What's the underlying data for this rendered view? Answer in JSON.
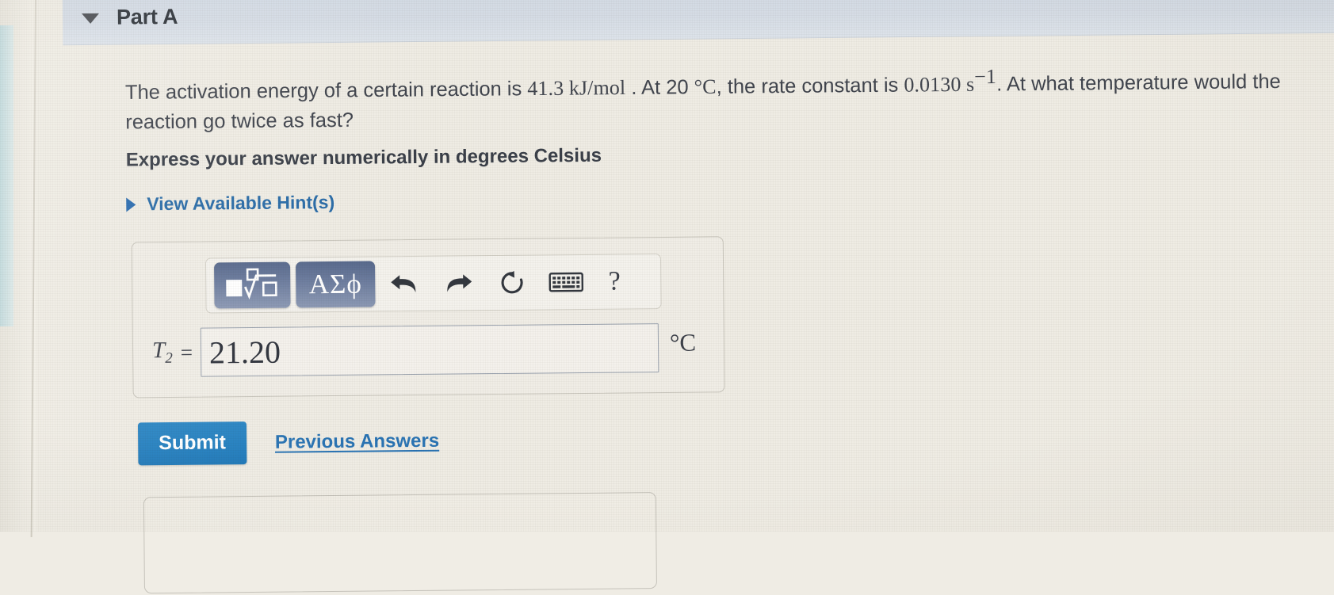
{
  "part": {
    "title": "Part A",
    "caret_icon": "triangle-down-icon"
  },
  "question": {
    "line1_pre": "The activation energy of a certain reaction is ",
    "activation_energy": "41.3 kJ/mol",
    "line1_mid": " . At 20 ",
    "temperature_unit": "°C",
    "line1_mid2": ", the rate constant is ",
    "rate_constant": "0.0130 s",
    "rate_constant_exponent": "−1",
    "line1_tail": ". At what temperature would the",
    "line2": "reaction go twice as fast?",
    "instruction": "Express your answer numerically in degrees Celsius"
  },
  "hints": {
    "label": "View Available Hint(s)",
    "caret_icon": "triangle-right-icon"
  },
  "toolbar": {
    "template_button": {
      "name": "math-template-button",
      "icon": "square-root-template-icon",
      "label": ""
    },
    "greek_button": {
      "name": "greek-symbols-button",
      "label": "ΑΣϕ"
    },
    "undo_icon": "undo-arrow-icon",
    "redo_icon": "redo-arrow-icon",
    "reset_icon": "reset-circular-arrow-icon",
    "keyboard_icon": "keyboard-icon",
    "help_label": "?"
  },
  "answer": {
    "variable": "T",
    "subscript": "2",
    "equals": "=",
    "value": "21.20",
    "placeholder": "",
    "unit": "°C"
  },
  "actions": {
    "submit_label": "Submit",
    "previous_answers_label": "Previous Answers"
  },
  "colors": {
    "accent_blue": "#2480c0",
    "link_blue": "#2a74b4",
    "header_bar": "#d5dce5",
    "toolbar_button": "#6b7b9d",
    "page_background": "#efece4",
    "teal_tab": "#cfe2e4"
  }
}
